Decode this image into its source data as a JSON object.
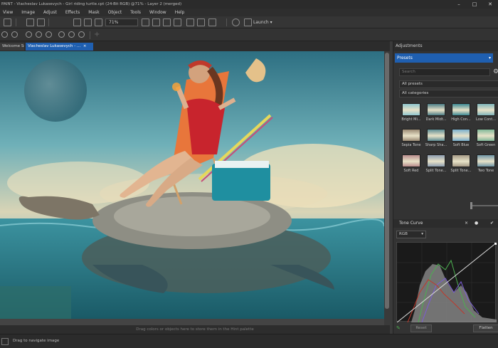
{
  "window": {
    "title": "PAINT - Viacheslav Lukasevych - Girl riding turtle.cpt (24-Bit RGB) @71% - Layer 2 (merged)",
    "minimize": "–",
    "maximize": "□",
    "close": "✕"
  },
  "menu": [
    "View",
    "Image",
    "Adjust",
    "Effects",
    "Mask",
    "Object",
    "Tools",
    "Window",
    "Help"
  ],
  "toolbar": {
    "zoom": "71%",
    "launch_label": "Launch"
  },
  "tabs": [
    "Welcome Screen",
    "Viacheslav Lukasevych - ..."
  ],
  "canvas": {
    "hint": "Drag colors or objects here to store them in the Hint palette"
  },
  "status": {
    "text": "Drag to navigate image"
  },
  "panel": {
    "title": "Adjustments",
    "preset_dropdown": "Presets",
    "search_placeholder": "Search",
    "filter_presets": "All presets",
    "filter_categories": "All categories",
    "presets": [
      {
        "label": "Bright Mi...",
        "color": "#8fc6cf"
      },
      {
        "label": "Dark Midt...",
        "color": "#4c7d86"
      },
      {
        "label": "High Con...",
        "color": "#3d8a94"
      },
      {
        "label": "Low Cont...",
        "color": "#7fb5bb"
      },
      {
        "label": "Sepia Tone",
        "color": "#9a8a74"
      },
      {
        "label": "Sharp Sha...",
        "color": "#5d8d95"
      },
      {
        "label": "Soft Blue",
        "color": "#7ab0cf"
      },
      {
        "label": "Soft Green",
        "color": "#82b99a"
      },
      {
        "label": "Soft Red",
        "color": "#b88c8c"
      },
      {
        "label": "Split Tone...",
        "color": "#8c9db0"
      },
      {
        "label": "Split Tone...",
        "color": "#a59a86"
      },
      {
        "label": "Two Tone",
        "color": "#6f95a6"
      }
    ],
    "tone_curve": {
      "title": "Tone Curve",
      "channel": "RGB",
      "reset_label": "Reset",
      "flatten_label": "Flatten"
    }
  },
  "colors": {
    "accent": "#1f5fb0"
  }
}
